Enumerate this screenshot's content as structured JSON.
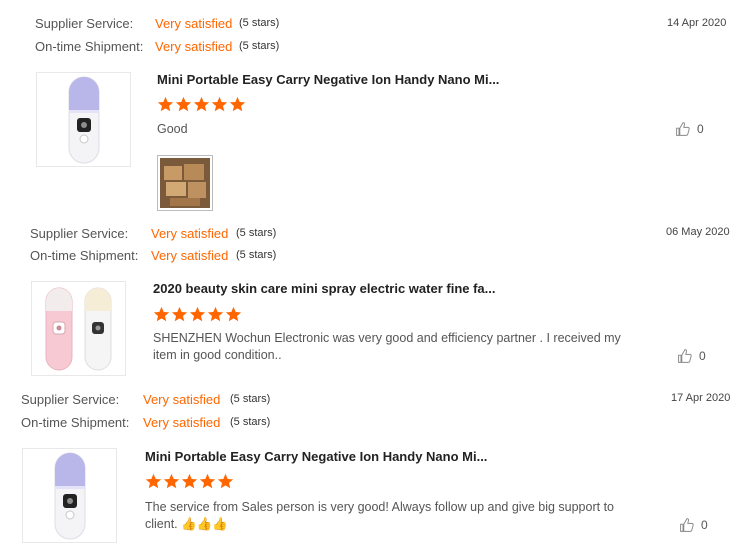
{
  "reviews": [
    {
      "supplier_label": "Supplier Service:",
      "supplier_value": "Very satisfied",
      "supplier_stars": "(5 stars)",
      "shipment_label": "On-time Shipment:",
      "shipment_value": "Very satisfied",
      "shipment_stars": "(5 stars)",
      "date": "14 Apr 2020",
      "product_name": "Mini Portable Easy Carry Negative Ion Handy Nano Mi...",
      "rating": 5,
      "comment": "Good",
      "likes": "0",
      "has_photo": true
    },
    {
      "supplier_label": "Supplier Service:",
      "supplier_value": "Very satisfied",
      "supplier_stars": "(5 stars)",
      "shipment_label": "On-time Shipment:",
      "shipment_value": "Very satisfied",
      "shipment_stars": "(5 stars)",
      "date": "06 May 2020",
      "product_name": "2020 beauty skin care mini spray electric water fine fa...",
      "rating": 5,
      "comment": "SHENZHEN Wochun Electronic was very good and efficiency partner . I received my item in good condition..",
      "likes": "0",
      "has_photo": false
    },
    {
      "supplier_label": "Supplier Service:",
      "supplier_value": "Very satisfied",
      "supplier_stars": "(5 stars)",
      "shipment_label": "On-time Shipment:",
      "shipment_value": "Very satisfied",
      "shipment_stars": "(5 stars)",
      "date": "17 Apr 2020",
      "product_name": "Mini Portable Easy Carry Negative Ion Handy Nano Mi...",
      "rating": 5,
      "comment": "The service from Sales person is very good! Always follow up and give big support to client. 👍👍👍",
      "likes": "0",
      "has_photo": false
    }
  ],
  "colors": {
    "accent": "#ff6600",
    "star": "#ff6600"
  }
}
